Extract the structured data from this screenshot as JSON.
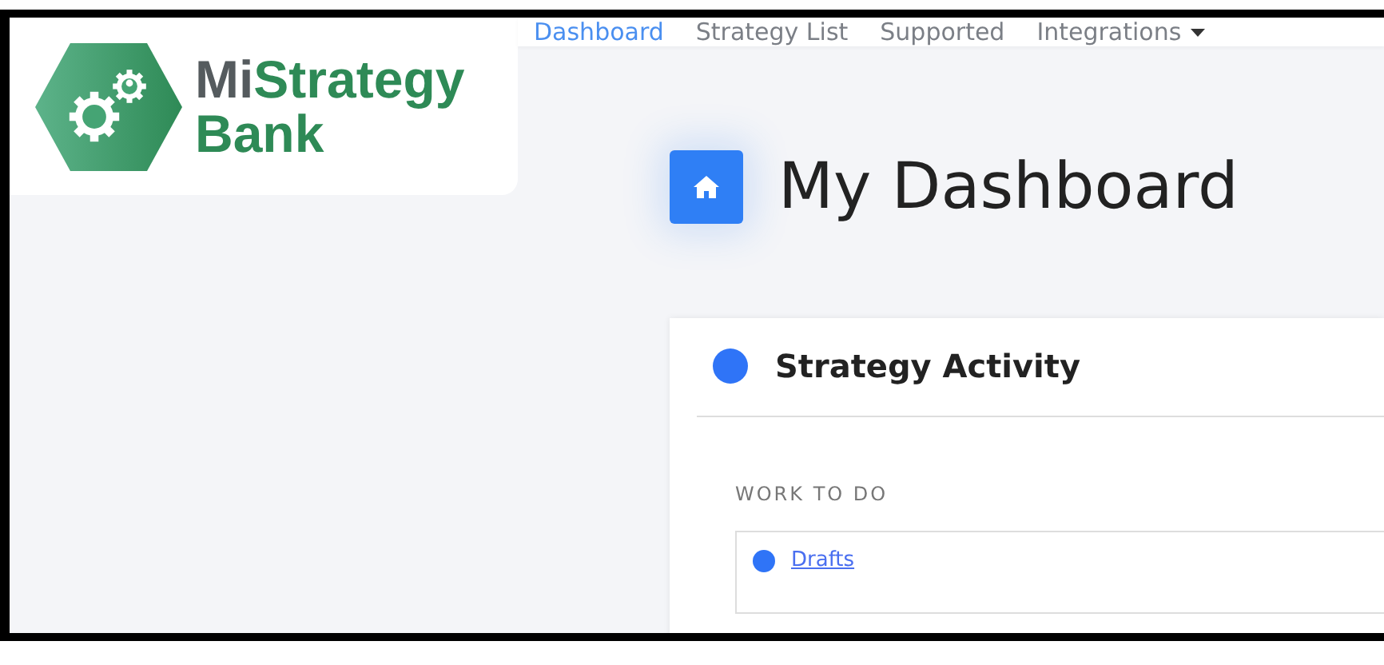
{
  "brand": {
    "name_first": "Mi",
    "name_second": "Strategy",
    "name_line2": "Bank"
  },
  "nav": [
    {
      "label": "Dashboard",
      "selected": true,
      "kind": "link"
    },
    {
      "label": "Strategy List",
      "selected": false,
      "kind": "link"
    },
    {
      "label": "Supported",
      "selected": false,
      "kind": "link"
    },
    {
      "label": "Integrations",
      "selected": false,
      "kind": "dropdown"
    }
  ],
  "page_title": "My Dashboard",
  "card": {
    "title": "Strategy Activity",
    "section_label": "WORK TO DO",
    "items": [
      {
        "label": "Drafts"
      }
    ]
  }
}
